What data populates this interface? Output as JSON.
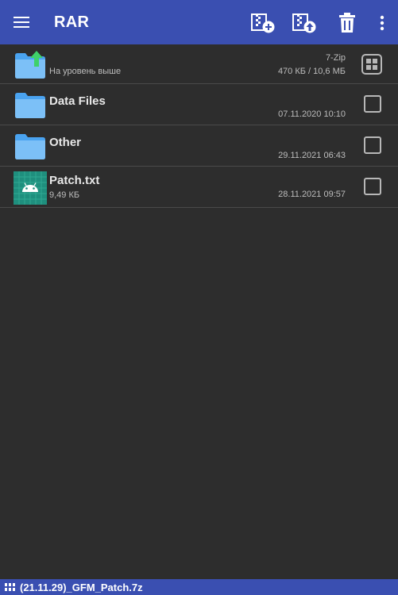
{
  "app": {
    "title": "RAR"
  },
  "colors": {
    "appbar": "#3a4fb1",
    "background": "#2d2d2d",
    "folder": "#4aa3f0",
    "up_arrow": "#3fd16a",
    "file_icon_bg": "#1f8f7e"
  },
  "toolbar": {
    "icons": [
      "add-to-archive-icon",
      "extract-archive-icon",
      "delete-icon",
      "more-options-icon"
    ]
  },
  "rows": [
    {
      "icon": "folder-up-icon",
      "name": "",
      "sub": "На уровень выше",
      "meta_top": "7-Zip",
      "meta_bottom": "470 КБ / 10,6 МБ"
    },
    {
      "icon": "folder-icon",
      "name": "Data Files",
      "sub": "",
      "meta_top": "",
      "meta_bottom": "07.11.2020 10:10"
    },
    {
      "icon": "folder-icon",
      "name": "Other",
      "sub": "",
      "meta_top": "",
      "meta_bottom": "29.11.2021 06:43"
    },
    {
      "icon": "android-file-icon",
      "name": "Patch.txt",
      "sub": "9,49 КБ",
      "meta_top": "",
      "meta_bottom": "28.11.2021 09:57"
    }
  ],
  "status": {
    "archive_name": "(21.11.29)_GFM_Patch.7z"
  }
}
